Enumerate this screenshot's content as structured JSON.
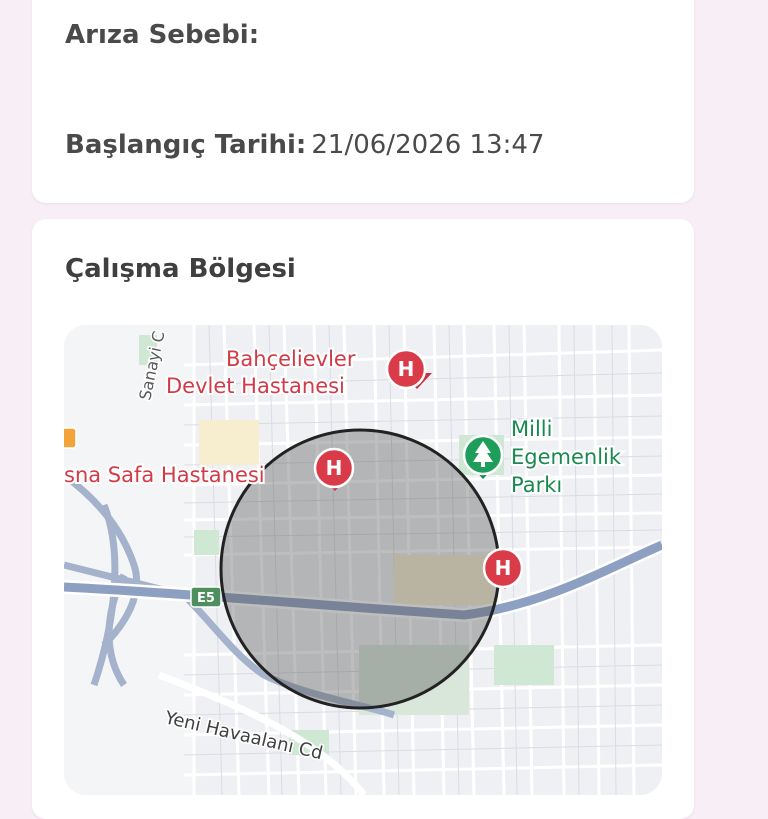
{
  "details": {
    "cause_label": "Arıza Sebebi:",
    "cause_value": "",
    "start_label": "Başlangıç Tarihi:",
    "start_value": "21/06/2026 13:47"
  },
  "work_area": {
    "title": "Çalışma Bölgesi",
    "map": {
      "place_labels": {
        "hospital_1_line1": "Bahçelievler",
        "hospital_1_line2": "Devlet Hastanesi",
        "hospital_2": "sna Safa Hastanesi",
        "park_line1": "Milli",
        "park_line2": "Egemenlik",
        "park_line3": "Parkı",
        "street_1": "Sanayi C",
        "street_2": "Yeni Havaalanı Cd",
        "highway": "E5",
        "hospital_marker": "H"
      },
      "colors": {
        "hospital_marker": "#d93b49",
        "park_marker": "#1e9e5a",
        "hospital_text": "#d23a48",
        "park_text": "#188a4f",
        "highway": "#8ea0c2",
        "zone_fill": "#555555"
      }
    }
  }
}
